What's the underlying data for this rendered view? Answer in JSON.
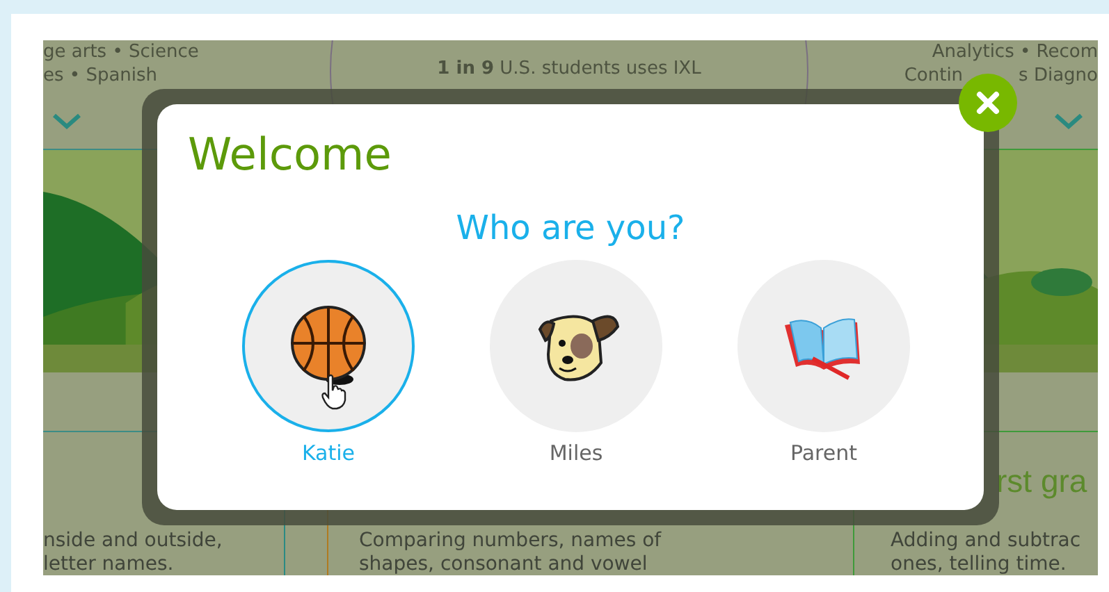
{
  "page_behind": {
    "columns": [
      {
        "header_lines": [
          [
            "ge arts • Science"
          ],
          [
            "es • Spanish"
          ]
        ],
        "chevron": true,
        "picture": true,
        "description_lines": [
          "nside and outside,",
          "letter names."
        ]
      },
      {
        "header_lines": [
          [
            "**1 in 9** U.S. students uses IXL"
          ]
        ],
        "chevron": false,
        "picture": false,
        "description_lines": [
          "Comparing numbers, names of",
          "shapes, consonant and vowel"
        ]
      },
      {
        "header_lines": [
          [
            "Analytics • Recom"
          ],
          [
            "Contin",
            "s Diagno"
          ]
        ],
        "chevron": true,
        "picture": true,
        "title": "rst gra",
        "description_lines": [
          "Adding and subtrac",
          "ones, telling time."
        ]
      }
    ]
  },
  "modal": {
    "title": "Welcome",
    "question": "Who are you?",
    "profiles": [
      {
        "name": "Katie",
        "kind": "basketball",
        "selected": true
      },
      {
        "name": "Miles",
        "kind": "dog",
        "selected": false
      },
      {
        "name": "Parent",
        "kind": "book",
        "selected": false
      }
    ]
  }
}
